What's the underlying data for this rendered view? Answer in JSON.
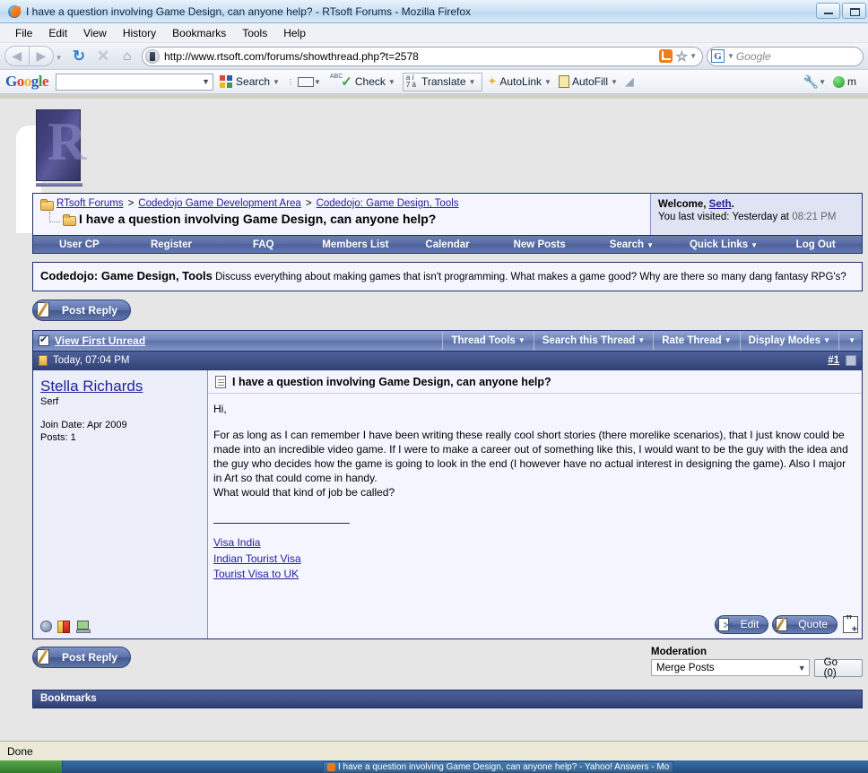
{
  "browser": {
    "title": "I have a question involving Game Design, can anyone help? - RTsoft Forums - Mozilla Firefox",
    "menus": [
      "File",
      "Edit",
      "View",
      "History",
      "Bookmarks",
      "Tools",
      "Help"
    ],
    "url": "http://www.rtsoft.com/forums/showthread.php?t=2578",
    "search_placeholder": "Google",
    "search_engine_badge": "G",
    "status": "Done"
  },
  "google_toolbar": {
    "logo": [
      "G",
      "o",
      "o",
      "g",
      "l",
      "e"
    ],
    "query": "",
    "items": [
      {
        "label": "Search"
      },
      {
        "label": "Check"
      },
      {
        "label": "Translate"
      },
      {
        "label": "AutoLink"
      },
      {
        "label": "AutoFill"
      }
    ],
    "ja_glyph_top": "a í",
    "ja_glyph_bottom": "7 ä",
    "settings_text": "m"
  },
  "forum": {
    "breadcrumb": [
      {
        "label": "RTsoft Forums"
      },
      {
        "label": "Codedojo Game Development Area"
      },
      {
        "label": "Codedojo: Game Design, Tools"
      }
    ],
    "separator": ">",
    "thread_title": "I have a question involving Game Design, can anyone help?",
    "welcome_prefix": "Welcome, ",
    "welcome_user": "Seth",
    "welcome_suffix": ".",
    "last_visited_label": "You last visited: Yesterday at ",
    "last_visited_time": "08:21 PM",
    "nav": [
      {
        "label": "User CP",
        "caret": false
      },
      {
        "label": "Register",
        "caret": false
      },
      {
        "label": "FAQ",
        "caret": false
      },
      {
        "label": "Members List",
        "caret": false
      },
      {
        "label": "Calendar",
        "caret": false
      },
      {
        "label": "New Posts",
        "caret": false
      },
      {
        "label": "Search",
        "caret": true
      },
      {
        "label": "Quick Links",
        "caret": true
      },
      {
        "label": "Log Out",
        "caret": false
      }
    ],
    "description_title": "Codedojo: Game Design, Tools",
    "description_body": " Discuss everything about making games that isn't programming. What makes a game good? Why are there so many dang fantasy RPG's?",
    "post_reply_label": "Post Reply",
    "view_first_unread": "View First Unread",
    "thread_tools": [
      {
        "label": "Thread Tools"
      },
      {
        "label": "Search this Thread"
      },
      {
        "label": "Rate Thread"
      },
      {
        "label": "Display Modes"
      }
    ]
  },
  "post": {
    "date": "Today, 07:04 PM",
    "number": "#1",
    "author": "Stella Richards",
    "author_title": "Serf",
    "join_date": "Join Date: Apr 2009",
    "post_count": "Posts: 1",
    "subject": "I have a question involving Game Design, can anyone help?",
    "paragraphs": [
      "Hi,",
      "For as long as I can remember I have been writing these really cool short stories (there morelike scenarios), that I just know could be made into an incredible video game. If I were to make a career out of something like this, I would want to be the guy with the idea and the guy who decides how the game is going to look in the end (I however have no actual interest in designing the game). Also I major in Art so that could come in handy.",
      "What would that kind of job be called?"
    ],
    "signature_links": [
      {
        "label": "Visa India"
      },
      {
        "label": "Indian Tourist Visa"
      },
      {
        "label": "Tourist Visa to UK"
      }
    ],
    "edit_label": "Edit",
    "quote_label": "Quote"
  },
  "footer": {
    "post_reply_label": "Post Reply",
    "moderation_label": "Moderation",
    "moderation_selected": "Merge Posts",
    "go_label": "Go (0)",
    "bookmarks_label": "Bookmarks"
  },
  "taskbar": {
    "items": [
      {
        "label": "I have a question involving Game Design, can anyone help? - Yahoo! Answers - Mo"
      }
    ]
  },
  "colors": {
    "forum_blue": "#1d2f6b",
    "link_blue": "#22229c",
    "nav_gradient_top": "#6b7fb5",
    "panel_bg": "#f5f5ff"
  }
}
